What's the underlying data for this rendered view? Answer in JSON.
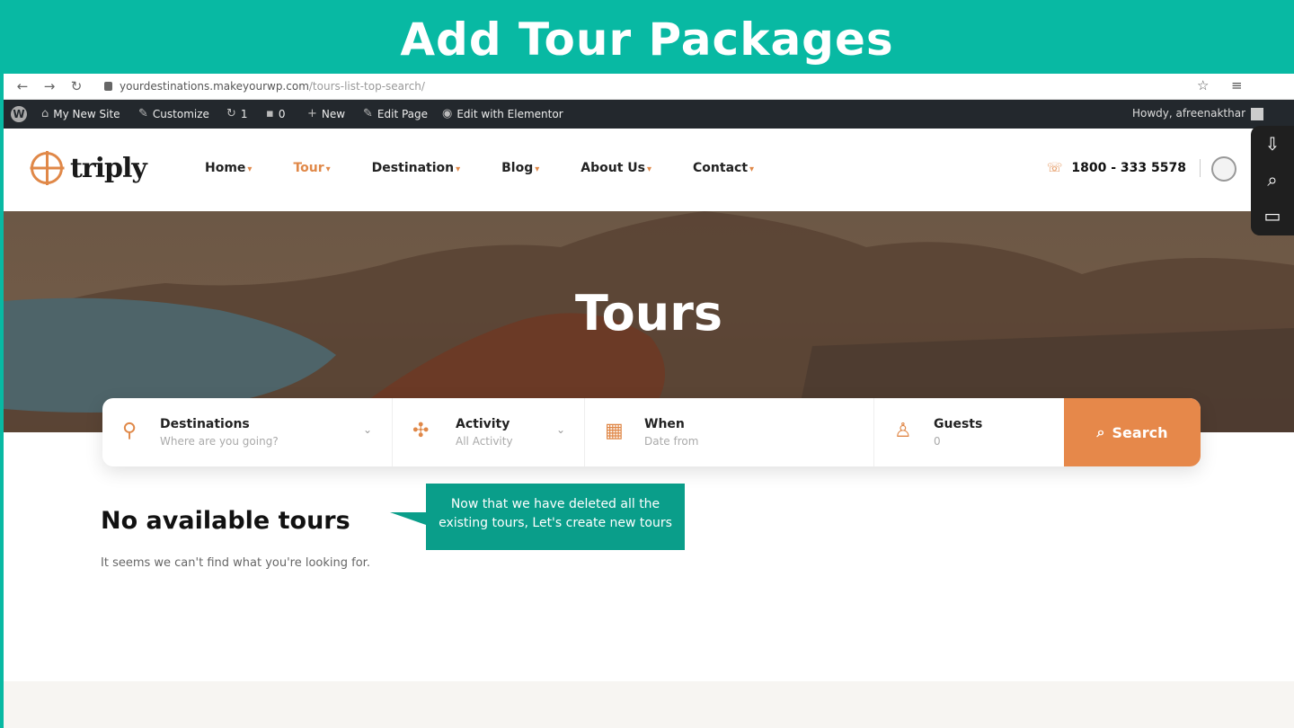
{
  "banner": {
    "title": "Add Tour Packages"
  },
  "browser": {
    "url_host": "yourdestinations.makeyourwp.com",
    "url_path": "/tours-list-top-search/"
  },
  "wp_admin_bar": {
    "items": [
      {
        "label": "My New Site",
        "icon": "home-icon"
      },
      {
        "label": "Customize",
        "icon": "brush-icon"
      },
      {
        "label": "1",
        "icon": "refresh-icon"
      },
      {
        "label": "0",
        "icon": "comment-icon"
      },
      {
        "label": "New",
        "icon": "plus-icon"
      },
      {
        "label": "Edit Page",
        "icon": "pencil-icon"
      },
      {
        "label": "Edit with Elementor",
        "icon": "elementor-icon"
      }
    ],
    "howdy": "Howdy, afreenakthar"
  },
  "site": {
    "logo_text": "triply",
    "menu": [
      {
        "label": "Home",
        "active": false
      },
      {
        "label": "Tour",
        "active": true
      },
      {
        "label": "Destination",
        "active": false
      },
      {
        "label": "Blog",
        "active": false
      },
      {
        "label": "About Us",
        "active": false
      },
      {
        "label": "Contact",
        "active": false
      }
    ],
    "phone": "1800 - 333 5578"
  },
  "hero": {
    "title": "Tours"
  },
  "search": {
    "destinations": {
      "label": "Destinations",
      "placeholder": "Where are you going?"
    },
    "activity": {
      "label": "Activity",
      "placeholder": "All Activity"
    },
    "when": {
      "label": "When",
      "placeholder": "Date from"
    },
    "guests": {
      "label": "Guests",
      "value": "0"
    },
    "button": "Search"
  },
  "content": {
    "heading": "No available tours",
    "subtext": "It seems we can't find what you're looking for."
  },
  "callout": {
    "text": "Now that we have deleted all the existing tours, Let's create new tours"
  },
  "colors": {
    "banner": "#08b9a3",
    "accent": "#e6884a",
    "callout": "#0a9e8a",
    "wpbar": "#23282d"
  }
}
